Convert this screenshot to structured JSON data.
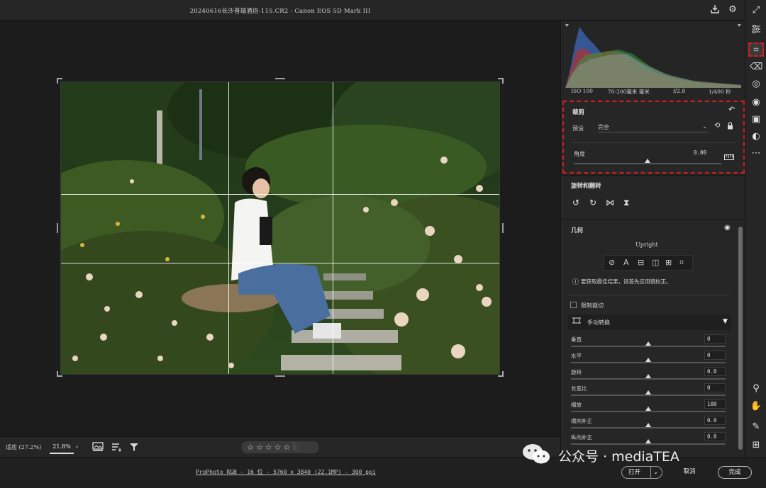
{
  "window": {
    "title": "20240616长沙普瑞酒店-115.CR2 -  Canon EOS 5D Mark III"
  },
  "titlebar_icons": [
    "save-icon",
    "gear-icon",
    "fullscreen-icon"
  ],
  "histogram": {
    "iso": "ISO 100",
    "lens": "70-200毫米 毫米",
    "aperture": "f/2.8",
    "shutter": "1/400 秒"
  },
  "crop": {
    "title": "裁剪",
    "preset_label": "预设",
    "preset_value": "完全",
    "angle_label": "角度",
    "angle_value": "0.00",
    "angle_level": 0.5
  },
  "rotate": {
    "title": "旋转和翻转"
  },
  "geometry": {
    "title": "几何",
    "upright_label": "Upright",
    "hint": "要获取最佳结果，请首先应用镜校正。",
    "constrain_crop": "限制裁切",
    "manual_transform": "手动转换",
    "sliders": [
      {
        "label": "垂直",
        "value": "0",
        "level": 0.5
      },
      {
        "label": "水平",
        "value": "0",
        "level": 0.5
      },
      {
        "label": "旋转",
        "value": "0.0",
        "level": 0.5
      },
      {
        "label": "长宽比",
        "value": "0",
        "level": 0.5
      },
      {
        "label": "缩放",
        "value": "100",
        "level": 0.5
      },
      {
        "label": "横向补正",
        "value": "0.0",
        "level": 0.5
      },
      {
        "label": "纵向补正",
        "value": "0.0",
        "level": 0.5
      }
    ]
  },
  "filmstrip": {
    "fit_label": "适应 (27.2%)",
    "zoom_value": "21.8%",
    "stars": "☆☆☆☆☆"
  },
  "status": {
    "info": "ProPhoto RGB - 16 位 - 5760 x 3840 (22.1MP) - 300 ppi",
    "open_button": "打开",
    "cancel_button": "取消",
    "done_button": "完成"
  },
  "watermark": {
    "text": "公众号 · mediaTEA"
  },
  "colors": {
    "highlight": "#d01f1f",
    "panel_bg": "#262626",
    "canvas_bg": "#1c1c1c"
  }
}
